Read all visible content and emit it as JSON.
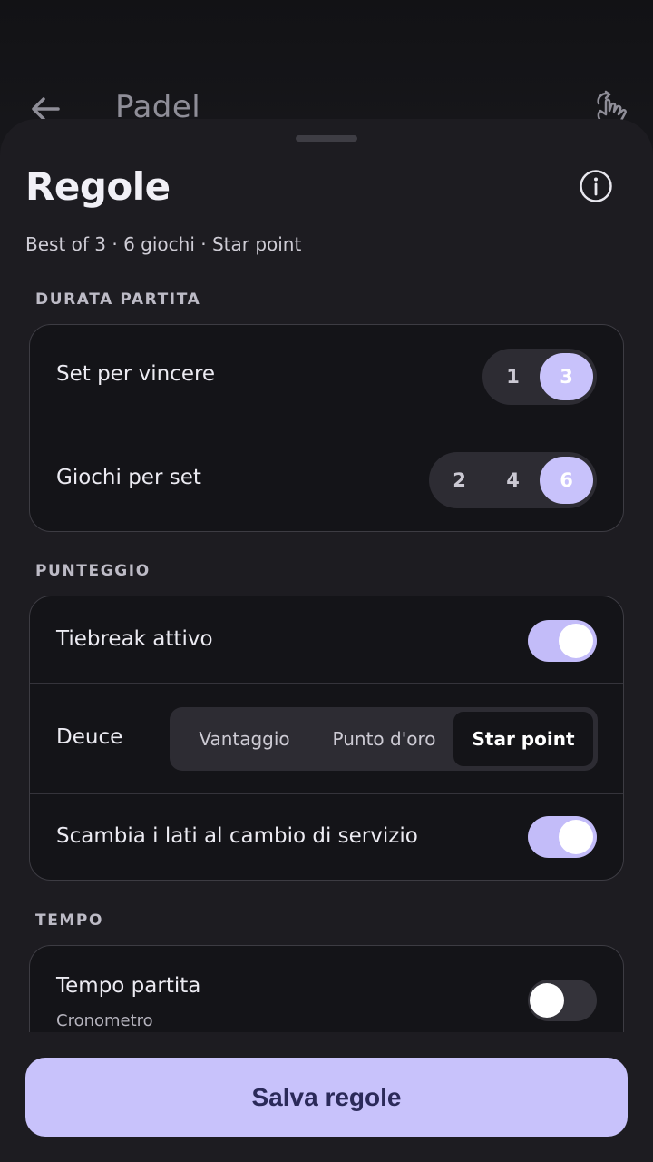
{
  "app_bar": {
    "title": "Padel"
  },
  "sheet": {
    "title": "Regole",
    "summary": "Best of 3 · 6 giochi · Star point"
  },
  "sections": {
    "durata": {
      "label": "DURATA PARTITA",
      "set_per_vincere": {
        "label": "Set per vincere",
        "options": [
          "1",
          "3"
        ],
        "selected": "3"
      },
      "giochi_per_set": {
        "label": "Giochi per set",
        "options": [
          "2",
          "4",
          "6"
        ],
        "selected": "6"
      }
    },
    "punteggio": {
      "label": "PUNTEGGIO",
      "tiebreak": {
        "label": "Tiebreak attivo",
        "on": true
      },
      "deuce": {
        "label": "Deuce",
        "options": [
          "Vantaggio",
          "Punto d'oro",
          "Star point"
        ],
        "selected": "Star point"
      },
      "scambia": {
        "label": "Scambia i lati al cambio di servizio",
        "on": true
      }
    },
    "tempo": {
      "label": "TEMPO",
      "tempo_partita": {
        "label": "Tempo partita",
        "sub": "Cronometro",
        "on": false
      }
    }
  },
  "footer": {
    "save_label": "Salva regole"
  },
  "colors": {
    "accent": "#c8c2fb",
    "sheet_bg": "#1d1c21",
    "card_bg": "#141418",
    "save_text": "#2b2a59"
  }
}
